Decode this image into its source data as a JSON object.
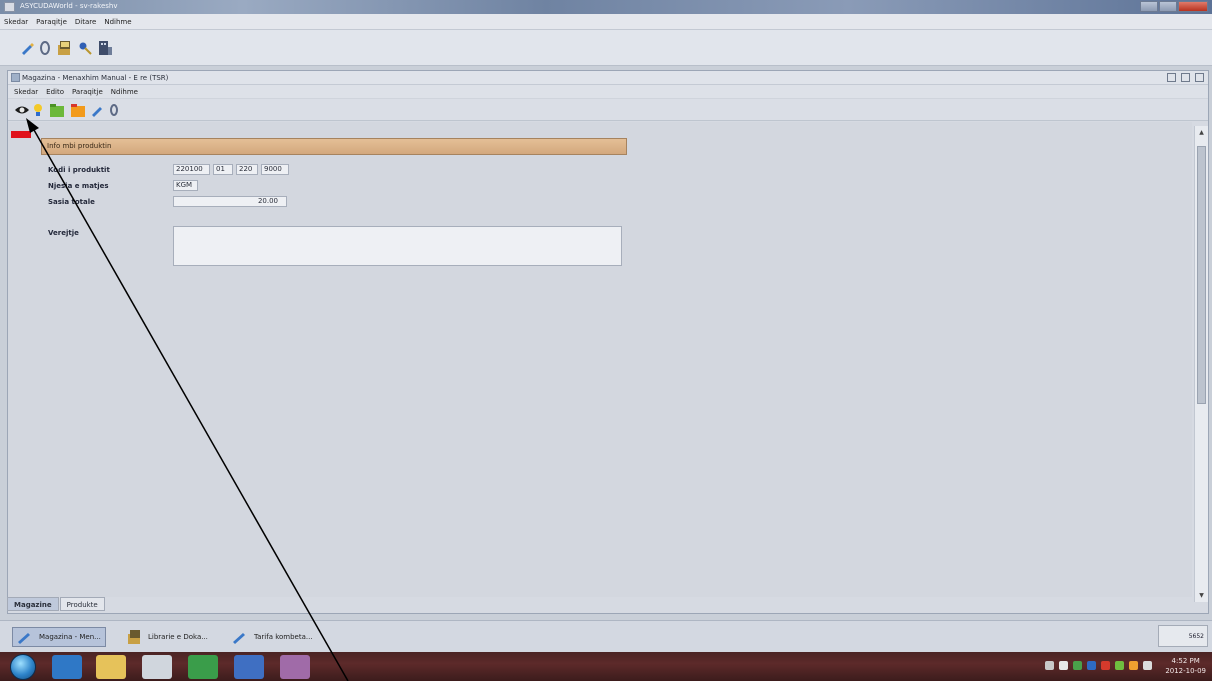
{
  "os_window": {
    "title": "ASYCUDAWorld - sv-rakeshv"
  },
  "outer_menu": [
    "Skedar",
    "Paraqitje",
    "Ditare",
    "Ndihme"
  ],
  "inner_window": {
    "title": "Magazina - Menaxhim Manual - E re (TSR)",
    "menu": [
      "Skedar",
      "Edito",
      "Paraqitje",
      "Ndihme"
    ]
  },
  "form": {
    "section_title": "Info mbi produktin",
    "fields": {
      "product_code_label": "Kodi i produktit",
      "product_code_parts": [
        "220100",
        "01",
        "220",
        "9000"
      ],
      "unit_label": "Njesia e matjes",
      "unit_value": "KGM",
      "total_qty_label": "Sasia totale",
      "total_qty_value": "20.00",
      "note_label": "Verejtje",
      "note_value": ""
    }
  },
  "bottom_tabs": [
    "Magazine",
    "Produkte"
  ],
  "app_taskbar": {
    "tasks": [
      "Magazina - Men...",
      "Librarie e Doka...",
      "Tarifa kombeta..."
    ],
    "right_widget": "5652"
  },
  "os_taskbar": {
    "time": "4:52 PM",
    "date": "2012-10-09"
  },
  "colors": {
    "section_header": "#d8af85",
    "red_marker": "#e0121c",
    "os_taskbar": "#5a2828"
  }
}
